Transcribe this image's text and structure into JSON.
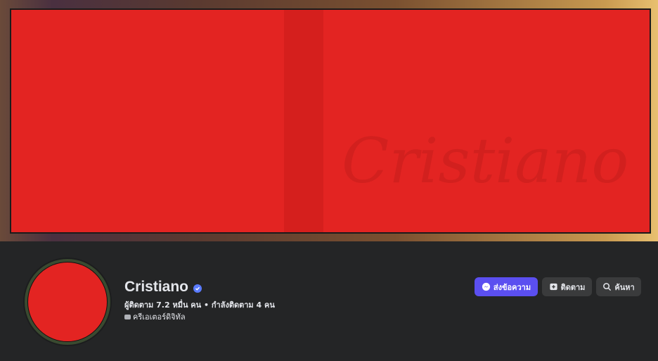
{
  "cover": {
    "watermark_text": "Cristiano"
  },
  "profile": {
    "name": "Cristiano",
    "verified": true,
    "stats": "ผู้ติดตาม 7.2 หมื่น คน • กำลังติดตาม 4 คน",
    "category": "ครีเอเตอร์ดิจิทัล"
  },
  "actions": {
    "message_label": "ส่งข้อความ",
    "follow_label": "ติดตาม",
    "search_label": "ค้นหา"
  },
  "colors": {
    "accent": "#5b4ff0",
    "cover_red": "#e32422",
    "page_bg": "#242526",
    "button_bg": "#3a3b3c",
    "verified": "#5a7bff"
  },
  "icons": {
    "message": "messenger-icon",
    "follow": "follow-icon",
    "search": "search-icon",
    "verified": "verified-badge-icon",
    "category": "category-icon"
  }
}
